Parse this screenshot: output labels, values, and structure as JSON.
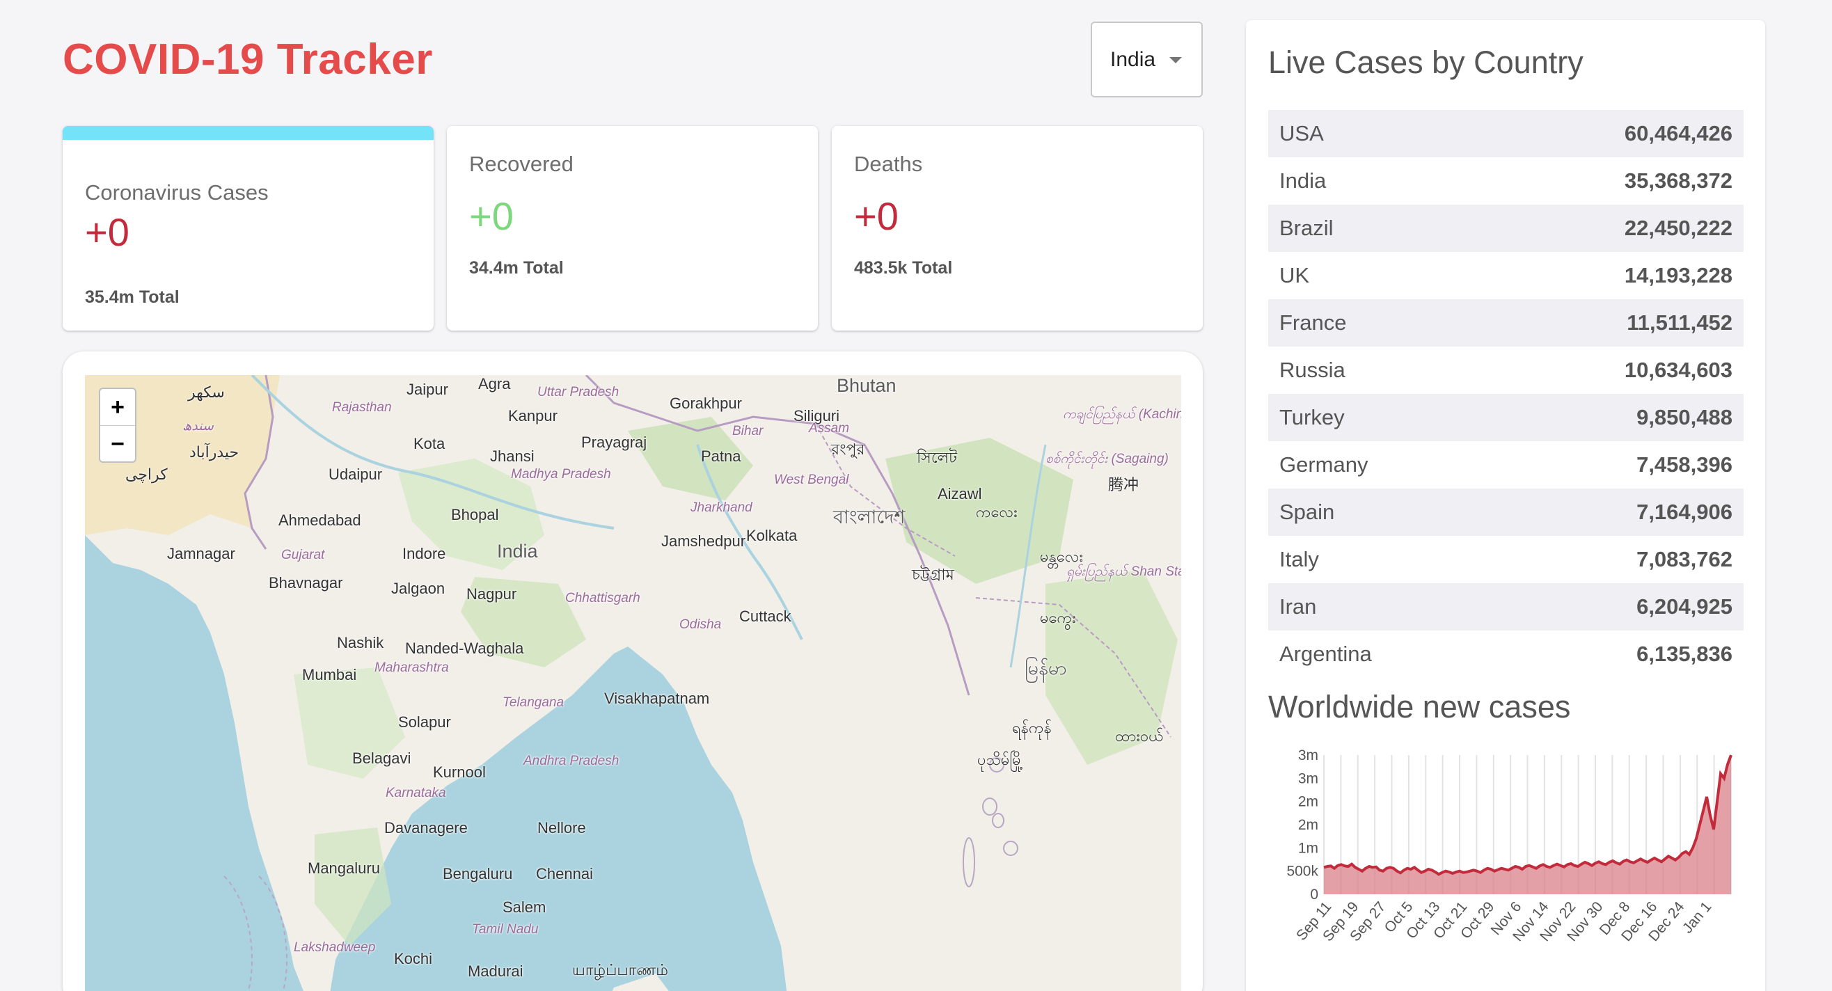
{
  "header": {
    "title": "COVID-19 Tracker",
    "country_selected": "India"
  },
  "cards": {
    "cases": {
      "title": "Coronavirus Cases",
      "value": "+0",
      "total": "35.4m Total"
    },
    "recovered": {
      "title": "Recovered",
      "value": "+0",
      "total": "34.4m Total"
    },
    "deaths": {
      "title": "Deaths",
      "value": "+0",
      "total": "483.5k Total"
    }
  },
  "map": {
    "zoom_in": "+",
    "zoom_out": "−",
    "labels": [
      {
        "text": "سکھر",
        "kind": "place"
      },
      {
        "text": "Jaipur",
        "kind": "place"
      },
      {
        "text": "Agra",
        "kind": "place"
      },
      {
        "text": "Uttar Pradesh",
        "kind": "region"
      },
      {
        "text": "Bhutan",
        "kind": "country"
      },
      {
        "text": "Rajasthan",
        "kind": "region"
      },
      {
        "text": "Kanpur",
        "kind": "place"
      },
      {
        "text": "Gorakhpur",
        "kind": "place"
      },
      {
        "text": "Siliguri",
        "kind": "place"
      },
      {
        "text": "ကချင်ပြည်နယ် (Kachin)",
        "kind": "region"
      },
      {
        "text": "سندھ",
        "kind": "region"
      },
      {
        "text": "حیدرآباد",
        "kind": "place"
      },
      {
        "text": "Kota",
        "kind": "place"
      },
      {
        "text": "Prayagraj",
        "kind": "place"
      },
      {
        "text": "Bihar",
        "kind": "region"
      },
      {
        "text": "Assam",
        "kind": "region"
      },
      {
        "text": "রংপুর",
        "kind": "place"
      },
      {
        "text": "Jhansi",
        "kind": "place"
      },
      {
        "text": "Patna",
        "kind": "place"
      },
      {
        "text": "সিলেট",
        "kind": "place"
      },
      {
        "text": "စစ်ကိုင်းတိုင်း (Sagaing)",
        "kind": "region"
      },
      {
        "text": "كراچی",
        "kind": "place"
      },
      {
        "text": "Udaipur",
        "kind": "place"
      },
      {
        "text": "Madhya Pradesh",
        "kind": "region"
      },
      {
        "text": "West Bengal",
        "kind": "region"
      },
      {
        "text": "Aizawl",
        "kind": "place"
      },
      {
        "text": "腾冲",
        "kind": "place"
      },
      {
        "text": "Ahmedabad",
        "kind": "place"
      },
      {
        "text": "Bhopal",
        "kind": "place"
      },
      {
        "text": "Jharkhand",
        "kind": "region"
      },
      {
        "text": "বাংলাদেশ",
        "kind": "country"
      },
      {
        "text": "ကလေး",
        "kind": "place"
      },
      {
        "text": "Jamnagar",
        "kind": "place"
      },
      {
        "text": "Gujarat",
        "kind": "region"
      },
      {
        "text": "Indore",
        "kind": "place"
      },
      {
        "text": "India",
        "kind": "country"
      },
      {
        "text": "Jamshedpur",
        "kind": "place"
      },
      {
        "text": "Kolkata",
        "kind": "place"
      },
      {
        "text": "မန္တလေး",
        "kind": "place"
      },
      {
        "text": "Bhavnagar",
        "kind": "place"
      },
      {
        "text": "Jalgaon",
        "kind": "place"
      },
      {
        "text": "Nagpur",
        "kind": "place"
      },
      {
        "text": "Chhattisgarh",
        "kind": "region"
      },
      {
        "text": "চট্টগ্রাম",
        "kind": "place"
      },
      {
        "text": "ရှမ်းပြည်နယ် Shan State",
        "kind": "region"
      },
      {
        "text": "Odisha",
        "kind": "region"
      },
      {
        "text": "Cuttack",
        "kind": "place"
      },
      {
        "text": "Nashik",
        "kind": "place"
      },
      {
        "text": "Nanded-Waghala",
        "kind": "place"
      },
      {
        "text": "မကွေး",
        "kind": "place"
      },
      {
        "text": "Mumbai",
        "kind": "place"
      },
      {
        "text": "Maharashtra",
        "kind": "region"
      },
      {
        "text": "မြန်မာ",
        "kind": "country"
      },
      {
        "text": "Telangana",
        "kind": "region"
      },
      {
        "text": "Visakhapatnam",
        "kind": "place"
      },
      {
        "text": "Solapur",
        "kind": "place"
      },
      {
        "text": "ရန်ကုန်",
        "kind": "place"
      },
      {
        "text": "ထားဝယ်",
        "kind": "place"
      },
      {
        "text": "Belagavi",
        "kind": "place"
      },
      {
        "text": "Kurnool",
        "kind": "place"
      },
      {
        "text": "Andhra Pradesh",
        "kind": "region"
      },
      {
        "text": "ပုသိမ်မြို့",
        "kind": "place"
      },
      {
        "text": "Karnataka",
        "kind": "region"
      },
      {
        "text": "Davanagere",
        "kind": "place"
      },
      {
        "text": "Nellore",
        "kind": "place"
      },
      {
        "text": "Mangaluru",
        "kind": "place"
      },
      {
        "text": "Bengaluru",
        "kind": "place"
      },
      {
        "text": "Chennai",
        "kind": "place"
      },
      {
        "text": "Salem",
        "kind": "place"
      },
      {
        "text": "Tamil Nadu",
        "kind": "region"
      },
      {
        "text": "Lakshadweep",
        "kind": "region"
      },
      {
        "text": "Kochi",
        "kind": "place"
      },
      {
        "text": "Madurai",
        "kind": "place"
      },
      {
        "text": "யாழ்ப்பாணம்",
        "kind": "place"
      }
    ]
  },
  "right_panel": {
    "title": "Live Cases by Country",
    "countries": [
      {
        "name": "USA",
        "cases": "60,464,426"
      },
      {
        "name": "India",
        "cases": "35,368,372"
      },
      {
        "name": "Brazil",
        "cases": "22,450,222"
      },
      {
        "name": "UK",
        "cases": "14,193,228"
      },
      {
        "name": "France",
        "cases": "11,511,452"
      },
      {
        "name": "Russia",
        "cases": "10,634,603"
      },
      {
        "name": "Turkey",
        "cases": "9,850,488"
      },
      {
        "name": "Germany",
        "cases": "7,458,396"
      },
      {
        "name": "Spain",
        "cases": "7,164,906"
      },
      {
        "name": "Italy",
        "cases": "7,083,762"
      },
      {
        "name": "Iran",
        "cases": "6,204,925"
      },
      {
        "name": "Argentina",
        "cases": "6,135,836"
      }
    ],
    "chart_title": "Worldwide new cases"
  },
  "colors": {
    "title_red": "#e64b4b",
    "value_red": "#c22b3b",
    "value_green": "#7dd87d",
    "selected_bar": "#74e2f7",
    "chart_line": "#c22b3b",
    "chart_fill": "#d98089",
    "water": "#aad3df",
    "land": "#f2efe9"
  },
  "chart_data": {
    "type": "area",
    "title": "",
    "xlabel": "",
    "ylabel": "",
    "ytick_labels": [
      "0",
      "500k",
      "1m",
      "2m",
      "2m",
      "3m",
      "3m"
    ],
    "ylim": [
      0,
      3000000
    ],
    "xtick_labels": [
      "Sep 11",
      "Sep 19",
      "Sep 27",
      "Oct 5",
      "Oct 13",
      "Oct 21",
      "Oct 29",
      "Nov 6",
      "Nov 14",
      "Nov 22",
      "Nov 30",
      "Dec 8",
      "Dec 16",
      "Dec 24",
      "Jan 1"
    ],
    "grid": "vertical",
    "series": [
      {
        "values": [
          580000,
          600000,
          610000,
          560000,
          620000,
          640000,
          610000,
          600000,
          650000,
          580000,
          540000,
          500000,
          560000,
          600000,
          580000,
          590000,
          520000,
          500000,
          560000,
          580000,
          560000,
          500000,
          460000,
          520000,
          560000,
          540000,
          580000,
          520000,
          470000,
          500000,
          540000,
          520000,
          480000,
          430000,
          470000,
          500000,
          480000,
          450000,
          480000,
          500000,
          470000,
          480000,
          500000,
          520000,
          500000,
          470000,
          520000,
          560000,
          540000,
          500000,
          530000,
          560000,
          540000,
          520000,
          560000,
          600000,
          580000,
          540000,
          600000,
          620000,
          590000,
          560000,
          610000,
          640000,
          600000,
          580000,
          620000,
          650000,
          620000,
          590000,
          640000,
          660000,
          620000,
          600000,
          650000,
          690000,
          660000,
          620000,
          670000,
          700000,
          660000,
          640000,
          690000,
          720000,
          680000,
          650000,
          710000,
          740000,
          700000,
          680000,
          720000,
          760000,
          720000,
          690000,
          740000,
          780000,
          740000,
          700000,
          760000,
          820000,
          780000,
          740000,
          800000,
          880000,
          920000,
          860000,
          1000000,
          1200000,
          1500000,
          1800000,
          2100000,
          1700000,
          1400000,
          2000000,
          2600000,
          2500000,
          2800000,
          3000000
        ]
      }
    ]
  }
}
